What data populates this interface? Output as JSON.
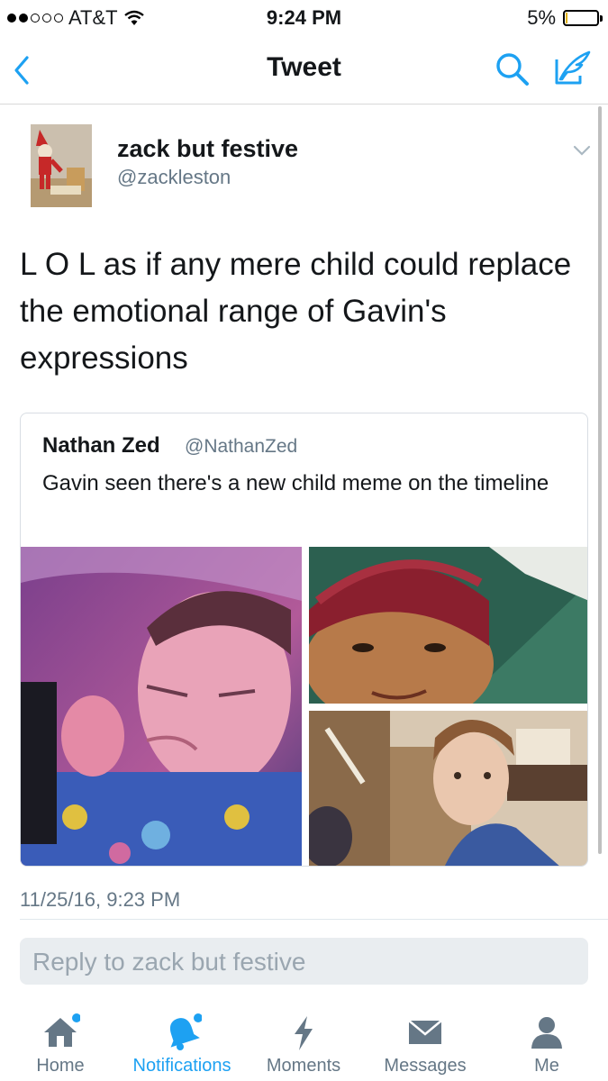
{
  "status_bar": {
    "carrier": "AT&T",
    "time": "9:24 PM",
    "battery": "5%",
    "battery_level": 0.05
  },
  "nav": {
    "title": "Tweet",
    "back_icon": "chevron-left-icon",
    "search_icon": "search-icon",
    "compose_icon": "compose-tweet-icon"
  },
  "tweet": {
    "name": "zack but festive",
    "handle": "@zackleston",
    "text": "L O L as if any mere child could replace the emotional range of Gavin's expressions",
    "timestamp": "11/25/16, 9:23 PM"
  },
  "quoted_tweet": {
    "name": "Nathan Zed",
    "handle": "@NathanZed",
    "text": "Gavin seen there's a new child meme on the timeline"
  },
  "reply": {
    "placeholder": "Reply to zack but festive"
  },
  "tab_bar": {
    "items": [
      {
        "label": "Home",
        "icon": "home-icon",
        "badge": true
      },
      {
        "label": "Notifications",
        "icon": "bell-icon",
        "badge": true,
        "active": true
      },
      {
        "label": "Moments",
        "icon": "lightning-icon"
      },
      {
        "label": "Messages",
        "icon": "envelope-icon"
      },
      {
        "label": "Me",
        "icon": "person-icon"
      }
    ]
  },
  "colors": {
    "accent": "#1da1f2",
    "muted": "#657786",
    "text": "#14171a"
  }
}
